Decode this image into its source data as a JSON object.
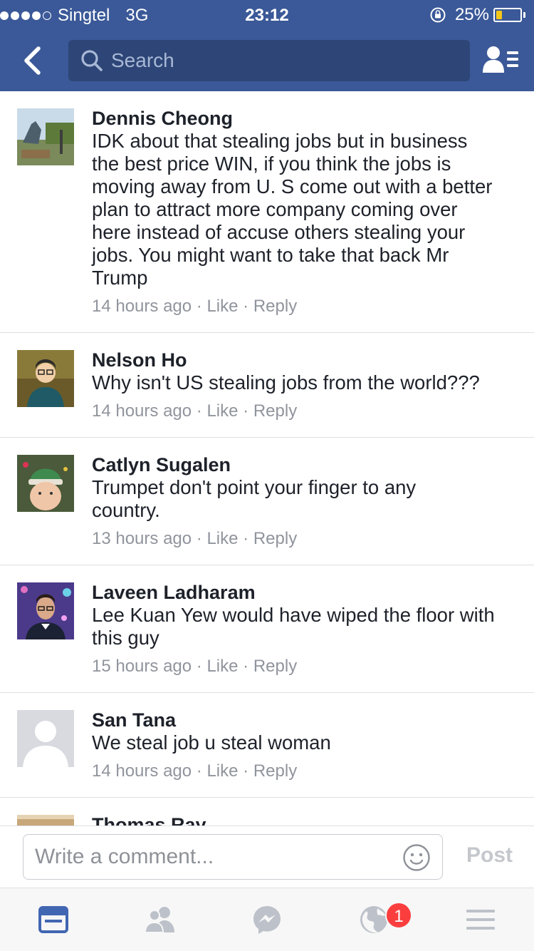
{
  "status_bar": {
    "carrier": "Singtel",
    "network": "3G",
    "time": "23:12",
    "battery_percent": "25%",
    "battery_level": 0.25,
    "signal_bars": 4,
    "battery_color": "#f5c518"
  },
  "nav": {
    "search_placeholder": "Search",
    "back_icon": "chevron-left-icon",
    "right_icon": "friend-requests-icon",
    "bar_color": "#3b5998"
  },
  "comments": [
    {
      "name": "Dennis Cheong",
      "lines": [
        "IDK about that stealing jobs but in business",
        "the best price WIN, if you think the jobs is",
        "moving away from U. S come out with a better",
        "plan to attract more company coming over",
        "here  instead of accuse others stealing your",
        "jobs. You might want to take that back Mr",
        "Trump"
      ],
      "time": "14 hours ago",
      "like": "Like",
      "reply": "Reply"
    },
    {
      "name": "Nelson Ho",
      "lines": [
        "Why isn't US stealing jobs from the world???"
      ],
      "time": "14 hours ago",
      "like": "Like",
      "reply": "Reply"
    },
    {
      "name": "Catlyn Sugalen",
      "lines": [
        "Trumpet don't point your finger to any",
        "country."
      ],
      "time": "13 hours ago",
      "like": "Like",
      "reply": "Reply"
    },
    {
      "name": "Laveen Ladharam",
      "lines": [
        "Lee Kuan Yew would have wiped the floor with",
        "this guy"
      ],
      "time": "15 hours ago",
      "like": "Like",
      "reply": "Reply"
    },
    {
      "name": "San Tana",
      "lines": [
        "We steal job u steal woman"
      ],
      "time": "14 hours ago",
      "like": "Like",
      "reply": "Reply"
    },
    {
      "name": "Thomas Ray",
      "lines": [],
      "time": "",
      "like": "",
      "reply": ""
    }
  ],
  "composer": {
    "placeholder": "Write a comment...",
    "post_label": "Post",
    "emoji_icon": "smiley-icon"
  },
  "tabbar": {
    "tabs": [
      "news-feed-icon",
      "friends-icon",
      "messenger-icon",
      "notifications-globe-icon",
      "menu-icon"
    ],
    "notifications_badge": "1",
    "active_color": "#4267b2",
    "inactive_color": "#bdc1c9"
  }
}
